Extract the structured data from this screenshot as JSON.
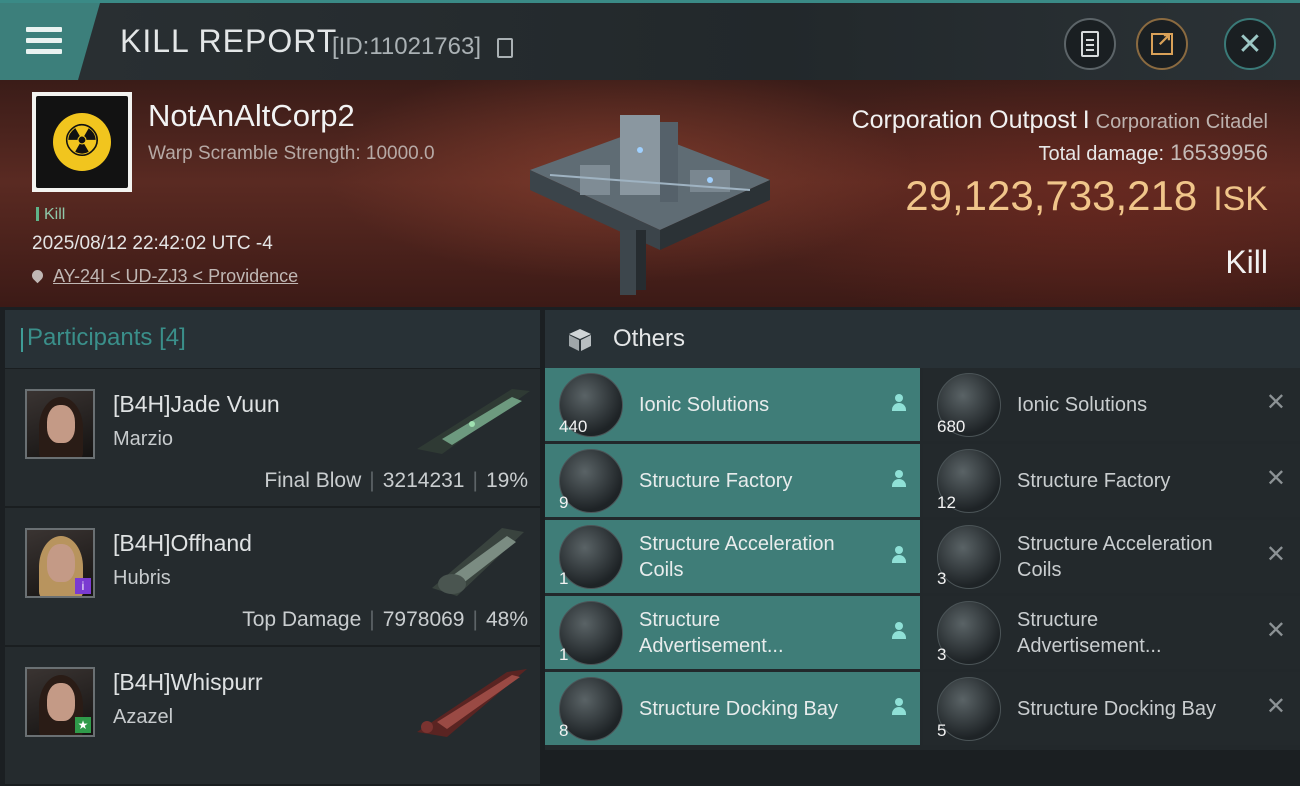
{
  "header": {
    "title": "KILL REPORT",
    "kill_id": "[ID:11021763]",
    "buttons": [
      "clipboard-icon",
      "share-icon",
      "close-icon"
    ]
  },
  "victim": {
    "corp_name": "NotAnAltCorp2",
    "warp_scramble": "Warp Scramble Strength: 10000.0",
    "kill_tag": "Kill",
    "timestamp": "2025/08/12 22:42:02 UTC -4",
    "location": "AY-24I < UD-ZJ3 < Providence",
    "target_name": "Corporation Outpost",
    "target_sep": "I",
    "target_type": "Corporation Citadel",
    "total_damage_label": "Total damage:",
    "total_damage_value": "16539956",
    "isk_value": "29,123,733,218",
    "isk_unit": "ISK",
    "result": "Kill"
  },
  "participants": {
    "label": "Participants",
    "count": "[4]",
    "rows": [
      {
        "name": "[B4H]Jade Vuun",
        "ship": "Marzio",
        "role": "Final Blow",
        "damage": "3214231",
        "percent": "19%"
      },
      {
        "name": "[B4H]Offhand",
        "ship": "Hubris",
        "role": "Top Damage",
        "damage": "7978069",
        "percent": "48%"
      },
      {
        "name": "[B4H]Whispurr",
        "ship": "Azazel",
        "role": "",
        "damage": "",
        "percent": ""
      }
    ]
  },
  "others": {
    "label": "Others",
    "dropped": [
      {
        "name": "Ionic Solutions",
        "qty": "440"
      },
      {
        "name": "Structure Factory",
        "qty": "9"
      },
      {
        "name": "Structure Acceleration Coils",
        "qty": "1"
      },
      {
        "name": "Structure Advertisement...",
        "qty": "1"
      },
      {
        "name": "Structure Docking Bay",
        "qty": "8"
      }
    ],
    "destroyed": [
      {
        "name": "Ionic Solutions",
        "qty": "680"
      },
      {
        "name": "Structure Factory",
        "qty": "12"
      },
      {
        "name": "Structure Acceleration Coils",
        "qty": "3"
      },
      {
        "name": "Structure Advertisement...",
        "qty": "3"
      },
      {
        "name": "Structure Docking Bay",
        "qty": "5"
      }
    ]
  },
  "colors": {
    "accent": "#3f7d78",
    "isk": "#f0c58a"
  }
}
